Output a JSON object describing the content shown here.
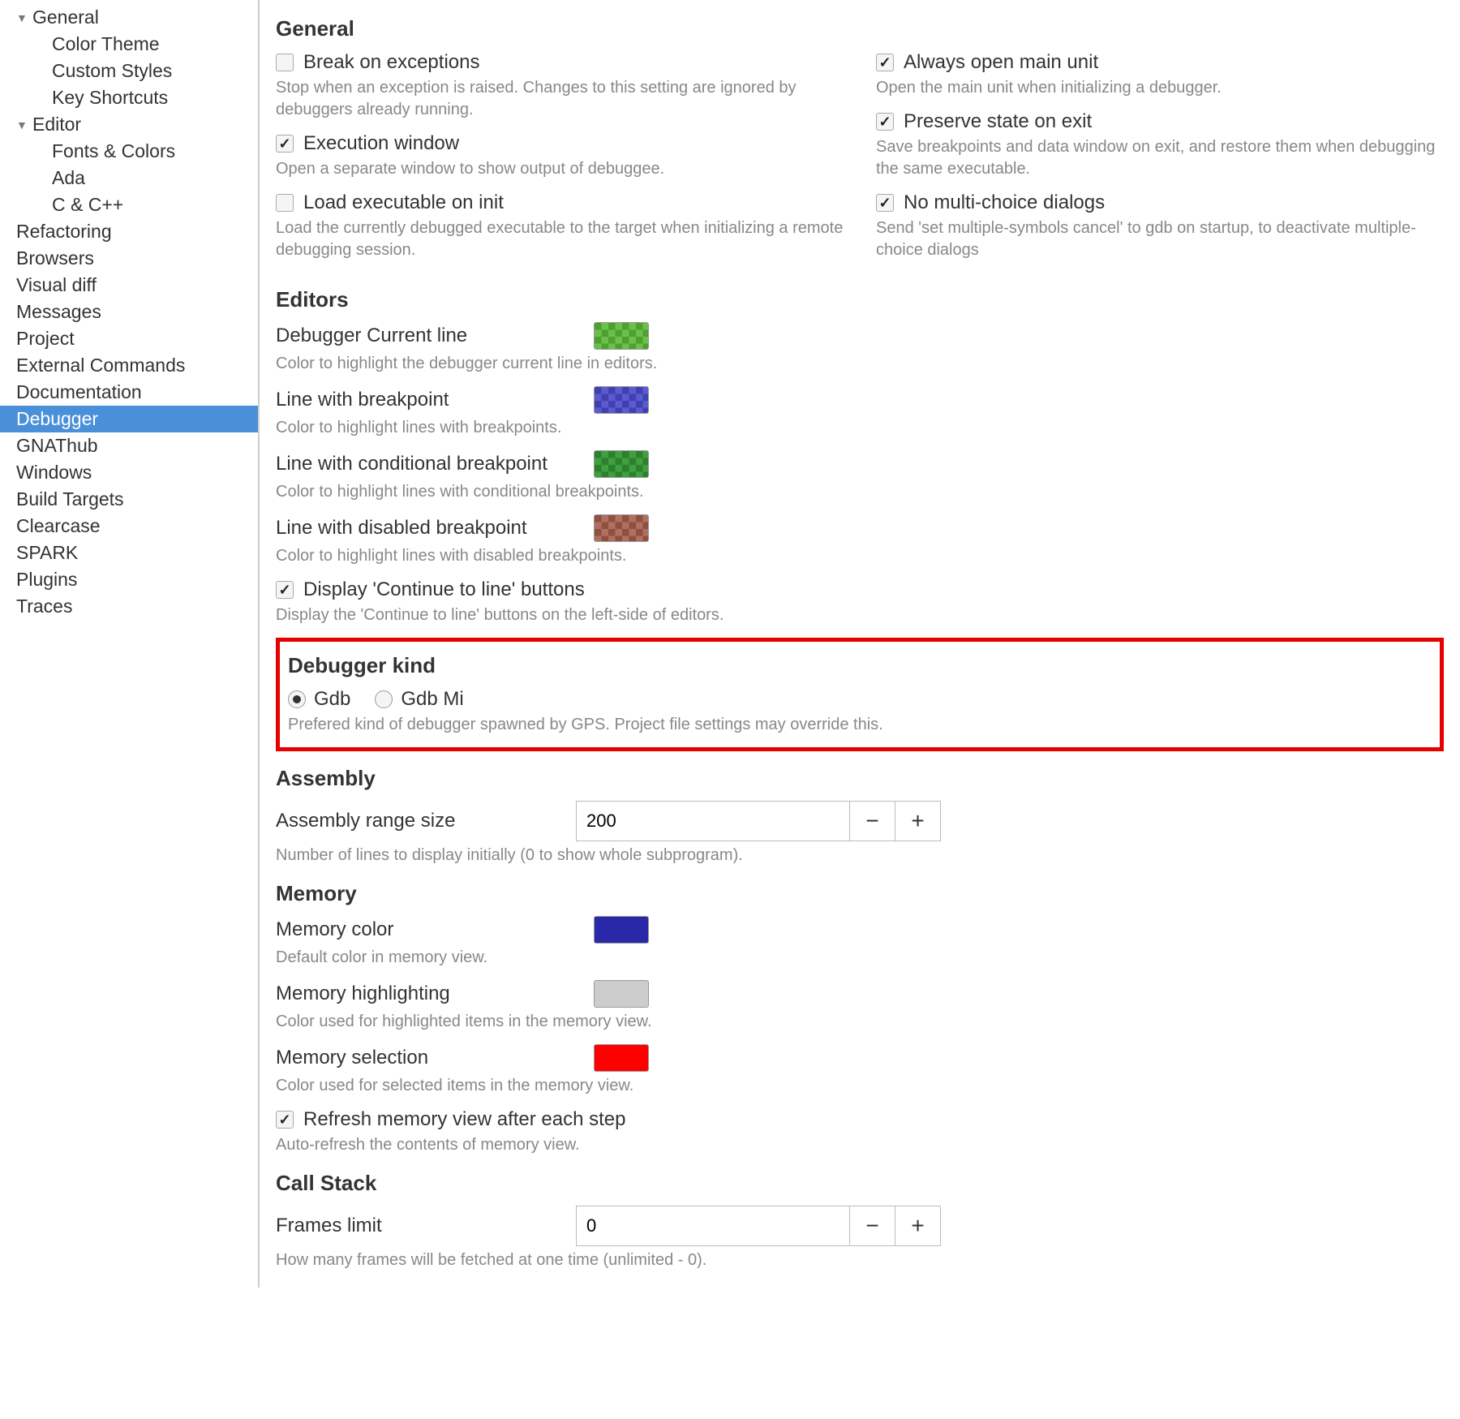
{
  "sidebar": {
    "items": [
      {
        "label": "General",
        "level": 1,
        "expand": true
      },
      {
        "label": "Color Theme",
        "level": 2
      },
      {
        "label": "Custom Styles",
        "level": 2
      },
      {
        "label": "Key Shortcuts",
        "level": 2
      },
      {
        "label": "Editor",
        "level": 1,
        "expand": true
      },
      {
        "label": "Fonts & Colors",
        "level": 2
      },
      {
        "label": "Ada",
        "level": 2
      },
      {
        "label": "C & C++",
        "level": 2
      },
      {
        "label": "Refactoring",
        "level": 1
      },
      {
        "label": "Browsers",
        "level": 1
      },
      {
        "label": "Visual diff",
        "level": 1
      },
      {
        "label": "Messages",
        "level": 1
      },
      {
        "label": "Project",
        "level": 1
      },
      {
        "label": "External Commands",
        "level": 1
      },
      {
        "label": "Documentation",
        "level": 1
      },
      {
        "label": "Debugger",
        "level": 1,
        "selected": true
      },
      {
        "label": "GNAThub",
        "level": 1
      },
      {
        "label": "Windows",
        "level": 1
      },
      {
        "label": "Build Targets",
        "level": 1
      },
      {
        "label": "Clearcase",
        "level": 1
      },
      {
        "label": "SPARK",
        "level": 1
      },
      {
        "label": "Plugins",
        "level": 1
      },
      {
        "label": "Traces",
        "level": 1
      }
    ]
  },
  "general": {
    "heading": "General",
    "left": [
      {
        "label": "Break on exceptions",
        "checked": false,
        "desc": "Stop when an exception is raised. Changes to this setting are ignored by debuggers already running."
      },
      {
        "label": "Execution window",
        "checked": true,
        "desc": "Open a separate window to show output of debuggee."
      },
      {
        "label": "Load executable on init",
        "checked": false,
        "desc": "Load the currently debugged executable to the target when initializing a remote debugging session."
      }
    ],
    "right": [
      {
        "label": "Always open main unit",
        "checked": true,
        "desc": "Open the main unit when initializing a debugger."
      },
      {
        "label": "Preserve state on exit",
        "checked": true,
        "desc": "Save breakpoints and data window on exit, and restore them when debugging the same executable."
      },
      {
        "label": "No multi-choice dialogs",
        "checked": true,
        "desc": "Send 'set multiple-symbols cancel' to gdb on startup, to deactivate multiple-choice dialogs"
      }
    ]
  },
  "editors": {
    "heading": "Editors",
    "colors": [
      {
        "label": "Debugger Current line",
        "class": "checker-green",
        "desc": "Color to highlight the debugger current line in editors."
      },
      {
        "label": "Line with breakpoint",
        "class": "checker-blue",
        "desc": "Color to highlight lines with breakpoints."
      },
      {
        "label": "Line with conditional breakpoint",
        "class": "checker-dgreen",
        "desc": "Color to highlight lines with conditional breakpoints."
      },
      {
        "label": "Line with disabled breakpoint",
        "class": "checker-brown",
        "desc": "Color to highlight lines with disabled breakpoints."
      }
    ],
    "continue_label": "Display 'Continue to line' buttons",
    "continue_desc": "Display the 'Continue to line' buttons on the left-side of editors."
  },
  "debugger_kind": {
    "heading": "Debugger kind",
    "options": [
      "Gdb",
      "Gdb Mi"
    ],
    "selected": 0,
    "desc": "Prefered kind of debugger spawned by GPS. Project file settings may override this."
  },
  "assembly": {
    "heading": "Assembly",
    "label": "Assembly range size",
    "value": "200",
    "desc": "Number of lines to display initially (0 to show whole subprogram)."
  },
  "memory": {
    "heading": "Memory",
    "colors": [
      {
        "label": "Memory color",
        "class": "solid-navy",
        "desc": "Default color in memory view."
      },
      {
        "label": "Memory highlighting",
        "class": "solid-grey",
        "desc": "Color used for highlighted items in the memory view."
      },
      {
        "label": "Memory selection",
        "class": "solid-red",
        "desc": "Color used for selected items in the memory view."
      }
    ],
    "refresh_label": "Refresh memory view after each step",
    "refresh_desc": "Auto-refresh the contents of memory view."
  },
  "callstack": {
    "heading": "Call Stack",
    "label": "Frames limit",
    "value": "0",
    "desc": "How many frames will be fetched at one time (unlimited - 0)."
  },
  "btn": {
    "minus": "−",
    "plus": "+"
  }
}
